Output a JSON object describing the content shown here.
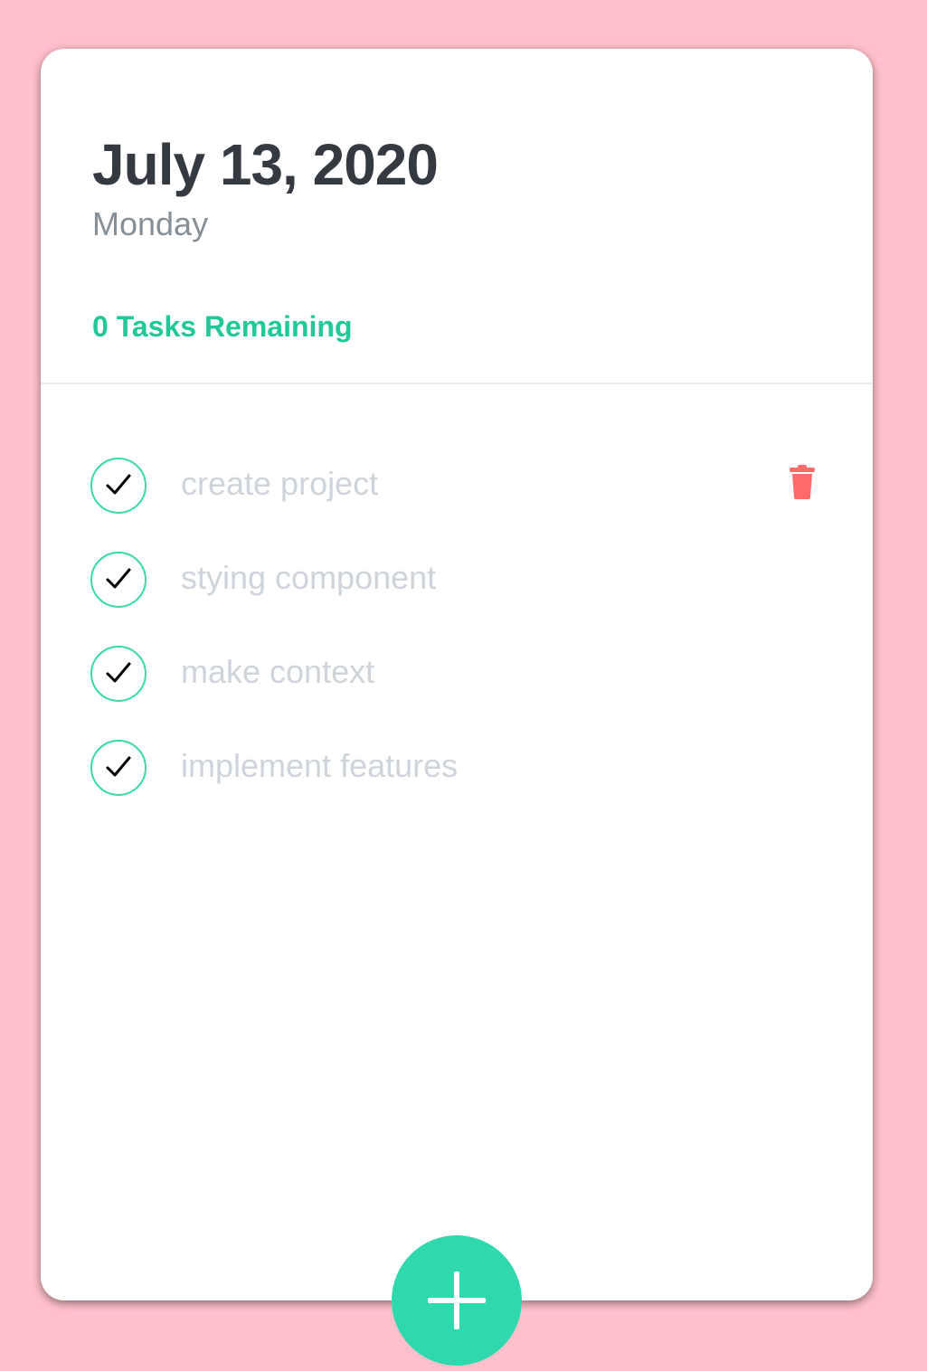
{
  "header": {
    "date": "July 13, 2020",
    "day": "Monday",
    "tasks_remaining": "0 Tasks Remaining"
  },
  "todos": [
    {
      "text": "create project",
      "done": true
    },
    {
      "text": "stying component",
      "done": true
    },
    {
      "text": "make context",
      "done": true
    },
    {
      "text": "implement features",
      "done": true
    }
  ],
  "icons": {
    "check": "check-icon",
    "delete": "trash-icon",
    "add": "plus-icon"
  },
  "colors": {
    "background": "#ffc0cb",
    "accent": "#20c997",
    "check_border": "#38d9a9",
    "fab": "#2fd9ad",
    "delete": "#ff6b6b",
    "done_text": "#ced4da"
  }
}
